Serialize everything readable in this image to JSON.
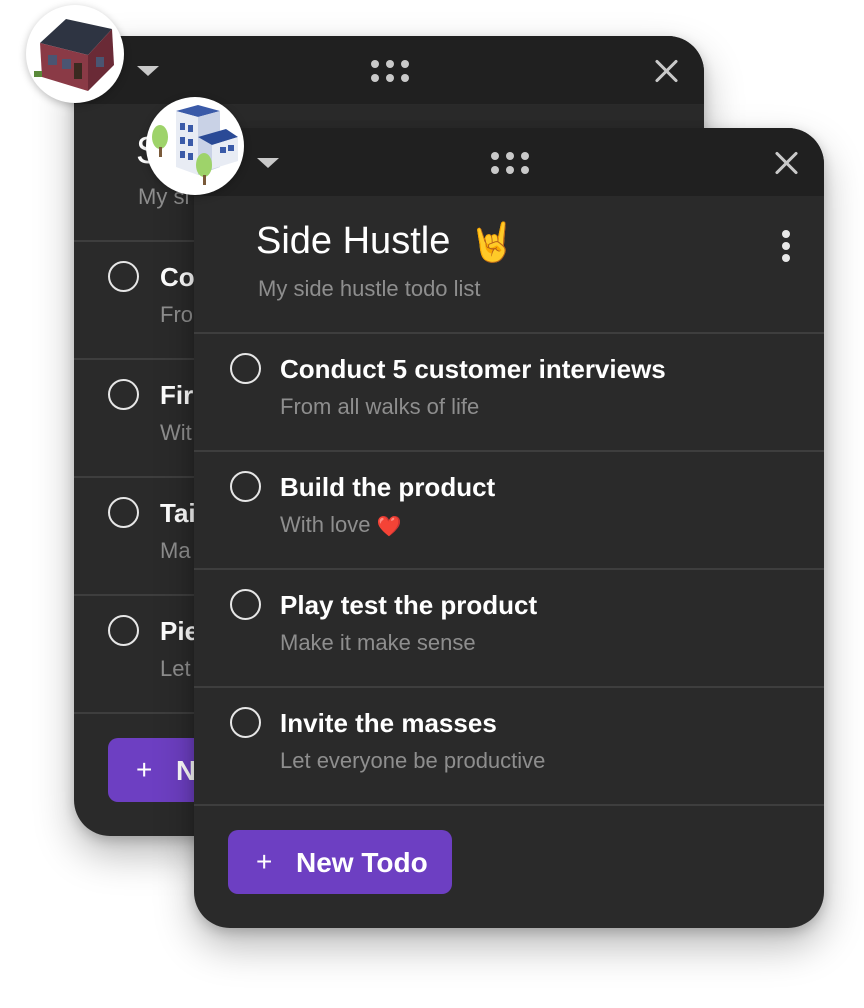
{
  "back_window": {
    "title": "S",
    "subtitle": "My si",
    "todos": [
      {
        "title": "Co",
        "subtitle": "Fro"
      },
      {
        "title": "Fir",
        "subtitle": "Wit"
      },
      {
        "title": "Tai",
        "subtitle": "Ma"
      },
      {
        "title": "Pie",
        "subtitle": "Let"
      }
    ],
    "new_button_label": "N",
    "new_button_icon": "+",
    "avatar_icon": "house-icon"
  },
  "front_window": {
    "title": "Side Hustle",
    "title_emoji": "🤘",
    "subtitle": "My side hustle todo list",
    "todos": [
      {
        "title": "Conduct 5 customer interviews",
        "subtitle": "From all walks of life"
      },
      {
        "title": "Build the product",
        "subtitle": "With love",
        "emoji": "❤️"
      },
      {
        "title": "Play test the product",
        "subtitle": "Make it make sense"
      },
      {
        "title": "Invite the masses",
        "subtitle": "Let everyone be productive"
      }
    ],
    "new_button_label": "New Todo",
    "new_button_icon": "+",
    "avatar_icon": "building-icon"
  },
  "colors": {
    "window_bg": "#2a2a2a",
    "titlebar_bg": "#202020",
    "accent": "#6d3fc2",
    "muted_text": "#8e8e8e"
  }
}
